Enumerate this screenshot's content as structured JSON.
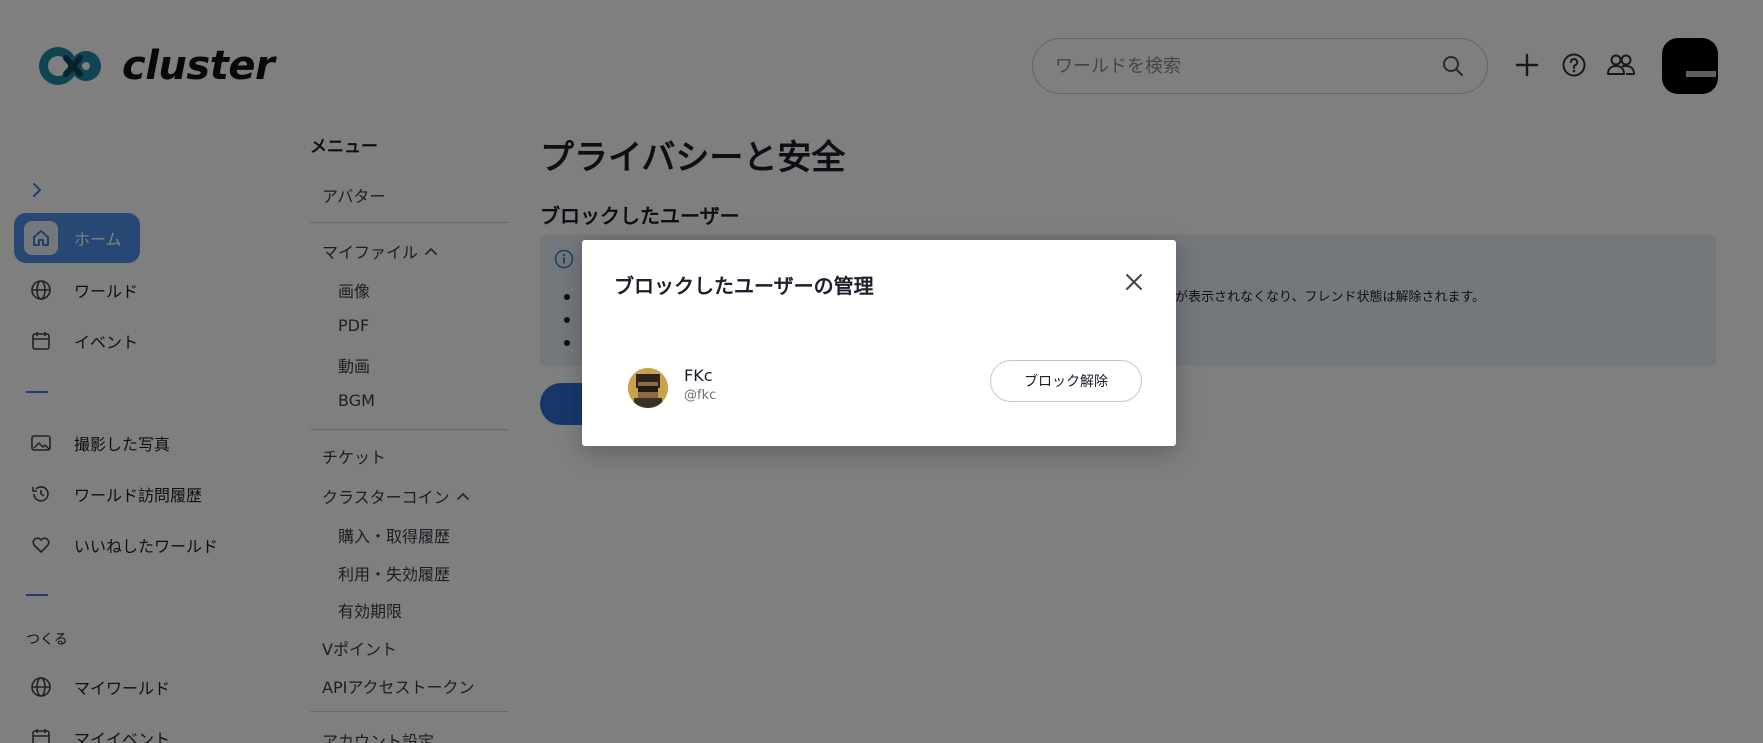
{
  "header": {
    "logo_text": "cluster",
    "search_placeholder": "ワールドを検索",
    "icons": [
      "search-icon",
      "plus-icon",
      "help-icon",
      "friends-icon"
    ]
  },
  "sidebar": {
    "items": [
      {
        "label": "ホーム",
        "icon": "home-icon",
        "active": true
      },
      {
        "label": "ワールド",
        "icon": "globe-icon"
      },
      {
        "label": "イベント",
        "icon": "calendar-icon"
      },
      {
        "label": "撮影した写真",
        "icon": "photo-icon"
      },
      {
        "label": "ワールド訪問履歴",
        "icon": "history-icon"
      },
      {
        "label": "いいねしたワールド",
        "icon": "heart-icon"
      },
      {
        "label": "マイワールド",
        "icon": "globe-icon"
      },
      {
        "label": "マイイベント",
        "icon": "calendar-icon"
      }
    ],
    "create_heading": "つくる"
  },
  "menu": {
    "title": "メニュー",
    "avatar": "アバター",
    "my_files": "マイファイル",
    "files": [
      "画像",
      "PDF",
      "動画",
      "BGM"
    ],
    "ticket": "チケット",
    "cluster_coin": "クラスターコイン",
    "coin_items": [
      "購入・取得履歴",
      "利用・失効履歴",
      "有効期限"
    ],
    "vpoint": "Vポイント",
    "api_token": "APIアクセストークン",
    "account_settings": "アカウント設定"
  },
  "main": {
    "page_title": "プライバシーと安全",
    "section_title": "ブロックしたユーザー",
    "info_visible_text": "が表示されなくなり、フレンド状態は解除されます。"
  },
  "modal": {
    "title": "ブロックしたユーザーの管理",
    "users": [
      {
        "name": "FKc",
        "handle": "@fkc",
        "action": "ブロック解除"
      }
    ]
  },
  "colors": {
    "accent": "#3d7fe0",
    "active_bg": "#4f8fe8",
    "info_bg": "#e7f0fb",
    "overlay": "rgba(0,0,0,0.5)"
  }
}
